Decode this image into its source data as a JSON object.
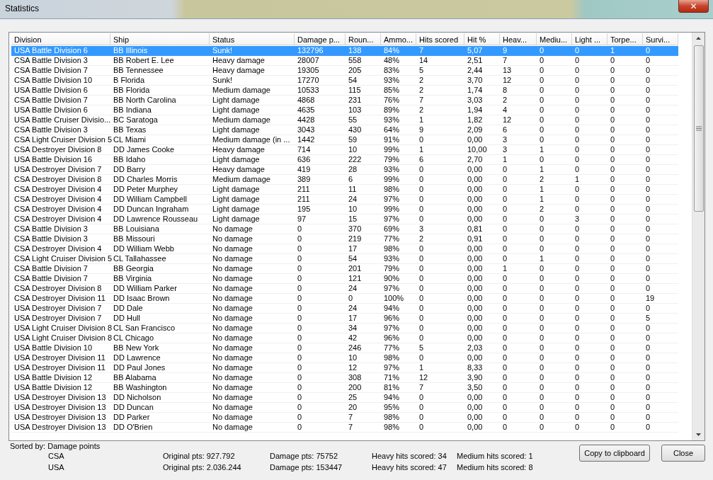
{
  "window": {
    "title": "Statistics",
    "close": "✕"
  },
  "table": {
    "columns": [
      "Division",
      "Ship",
      "Status",
      "Damage p...",
      "Roun...",
      "Ammo...",
      "Hits scored",
      "Hit %",
      "Heav...",
      "Mediu...",
      "Light ...",
      "Torpe...",
      "Survi..."
    ],
    "rows": [
      {
        "selected": true,
        "cells": [
          "USA Battle Division 6",
          "BB Illinois",
          "Sunk!",
          "132796",
          "138",
          "84%",
          "7",
          "5,07",
          "9",
          "0",
          "0",
          "1",
          "0"
        ]
      },
      {
        "selected": false,
        "cells": [
          "CSA Battle Division 3",
          "BB Robert E. Lee",
          "Heavy damage",
          "28007",
          "558",
          "48%",
          "14",
          "2,51",
          "7",
          "0",
          "0",
          "0",
          "0"
        ]
      },
      {
        "selected": false,
        "cells": [
          "CSA Battle Division 7",
          "BB Tennessee",
          "Heavy damage",
          "19305",
          "205",
          "83%",
          "5",
          "2,44",
          "13",
          "0",
          "0",
          "0",
          "0"
        ]
      },
      {
        "selected": false,
        "cells": [
          "CSA Battle Division 10",
          "B Florida",
          "Sunk!",
          "17270",
          "54",
          "93%",
          "2",
          "3,70",
          "12",
          "0",
          "0",
          "0",
          "0"
        ]
      },
      {
        "selected": false,
        "cells": [
          "USA Battle Division 6",
          "BB Florida",
          "Medium damage",
          "10533",
          "115",
          "85%",
          "2",
          "1,74",
          "8",
          "0",
          "0",
          "0",
          "0"
        ]
      },
      {
        "selected": false,
        "cells": [
          "CSA Battle Division 7",
          "BB North Carolina",
          "Light damage",
          "4868",
          "231",
          "76%",
          "7",
          "3,03",
          "2",
          "0",
          "0",
          "0",
          "0"
        ]
      },
      {
        "selected": false,
        "cells": [
          "USA Battle Division 6",
          "BB Indiana",
          "Light damage",
          "4635",
          "103",
          "89%",
          "2",
          "1,94",
          "4",
          "0",
          "0",
          "0",
          "0"
        ]
      },
      {
        "selected": false,
        "cells": [
          "USA Battle Cruiser Divisio...",
          "BC Saratoga",
          "Medium damage",
          "4428",
          "55",
          "93%",
          "1",
          "1,82",
          "12",
          "0",
          "0",
          "0",
          "0"
        ]
      },
      {
        "selected": false,
        "cells": [
          "CSA Battle Division 3",
          "BB Texas",
          "Light damage",
          "3043",
          "430",
          "64%",
          "9",
          "2,09",
          "6",
          "0",
          "0",
          "0",
          "0"
        ]
      },
      {
        "selected": false,
        "cells": [
          "CSA Light Cruiser Division 5",
          "CL Miami",
          "Medium damage (in ...",
          "1442",
          "59",
          "91%",
          "0",
          "0,00",
          "3",
          "0",
          "0",
          "0",
          "0"
        ]
      },
      {
        "selected": false,
        "cells": [
          "CSA Destroyer Division 8",
          "DD James Cooke",
          "Heavy damage",
          "714",
          "10",
          "99%",
          "1",
          "10,00",
          "3",
          "1",
          "0",
          "0",
          "0"
        ]
      },
      {
        "selected": false,
        "cells": [
          "USA Battle Division 16",
          "BB Idaho",
          "Light damage",
          "636",
          "222",
          "79%",
          "6",
          "2,70",
          "1",
          "0",
          "0",
          "0",
          "0"
        ]
      },
      {
        "selected": false,
        "cells": [
          "USA Destroyer Division 7",
          "DD Barry",
          "Heavy damage",
          "419",
          "28",
          "93%",
          "0",
          "0,00",
          "0",
          "1",
          "0",
          "0",
          "0"
        ]
      },
      {
        "selected": false,
        "cells": [
          "CSA Destroyer Division 8",
          "DD Charles Morris",
          "Medium damage",
          "389",
          "6",
          "99%",
          "0",
          "0,00",
          "0",
          "2",
          "1",
          "0",
          "0"
        ]
      },
      {
        "selected": false,
        "cells": [
          "CSA Destroyer Division 4",
          "DD Peter Murphey",
          "Light damage",
          "211",
          "11",
          "98%",
          "0",
          "0,00",
          "0",
          "1",
          "0",
          "0",
          "0"
        ]
      },
      {
        "selected": false,
        "cells": [
          "CSA Destroyer Division 4",
          "DD William Campbell",
          "Light damage",
          "211",
          "24",
          "97%",
          "0",
          "0,00",
          "0",
          "1",
          "0",
          "0",
          "0"
        ]
      },
      {
        "selected": false,
        "cells": [
          "CSA Destroyer Division 4",
          "DD Duncan Ingraham",
          "Light damage",
          "195",
          "10",
          "99%",
          "0",
          "0,00",
          "0",
          "2",
          "0",
          "0",
          "0"
        ]
      },
      {
        "selected": false,
        "cells": [
          "CSA Destroyer Division 4",
          "DD Lawrence Rousseau",
          "Light damage",
          "97",
          "15",
          "97%",
          "0",
          "0,00",
          "0",
          "0",
          "3",
          "0",
          "0"
        ]
      },
      {
        "selected": false,
        "cells": [
          "CSA Battle Division 3",
          "BB Louisiana",
          "No damage",
          "0",
          "370",
          "69%",
          "3",
          "0,81",
          "0",
          "0",
          "0",
          "0",
          "0"
        ]
      },
      {
        "selected": false,
        "cells": [
          "CSA Battle Division 3",
          "BB Missouri",
          "No damage",
          "0",
          "219",
          "77%",
          "2",
          "0,91",
          "0",
          "0",
          "0",
          "0",
          "0"
        ]
      },
      {
        "selected": false,
        "cells": [
          "CSA Destroyer Division 4",
          "DD William Webb",
          "No damage",
          "0",
          "17",
          "98%",
          "0",
          "0,00",
          "0",
          "0",
          "0",
          "0",
          "0"
        ]
      },
      {
        "selected": false,
        "cells": [
          "CSA Light Cruiser Division 5",
          "CL Tallahassee",
          "No damage",
          "0",
          "54",
          "93%",
          "0",
          "0,00",
          "0",
          "1",
          "0",
          "0",
          "0"
        ]
      },
      {
        "selected": false,
        "cells": [
          "CSA Battle Division 7",
          "BB Georgia",
          "No damage",
          "0",
          "201",
          "79%",
          "0",
          "0,00",
          "1",
          "0",
          "0",
          "0",
          "0"
        ]
      },
      {
        "selected": false,
        "cells": [
          "CSA Battle Division 7",
          "BB Virginia",
          "No damage",
          "0",
          "121",
          "90%",
          "0",
          "0,00",
          "0",
          "0",
          "0",
          "0",
          "0"
        ]
      },
      {
        "selected": false,
        "cells": [
          "CSA Destroyer Division 8",
          "DD William Parker",
          "No damage",
          "0",
          "24",
          "97%",
          "0",
          "0,00",
          "0",
          "0",
          "0",
          "0",
          "0"
        ]
      },
      {
        "selected": false,
        "cells": [
          "CSA Destroyer Division 11",
          "DD Isaac Brown",
          "No damage",
          "0",
          "0",
          "100%",
          "0",
          "0,00",
          "0",
          "0",
          "0",
          "0",
          "19"
        ]
      },
      {
        "selected": false,
        "cells": [
          "USA Destroyer Division 7",
          "DD Dale",
          "No damage",
          "0",
          "24",
          "94%",
          "0",
          "0,00",
          "0",
          "0",
          "0",
          "0",
          "0"
        ]
      },
      {
        "selected": false,
        "cells": [
          "USA Destroyer Division 7",
          "DD Hull",
          "No damage",
          "0",
          "17",
          "96%",
          "0",
          "0,00",
          "0",
          "0",
          "0",
          "0",
          "5"
        ]
      },
      {
        "selected": false,
        "cells": [
          "USA Light Cruiser Division 8",
          "CL San Francisco",
          "No damage",
          "0",
          "34",
          "97%",
          "0",
          "0,00",
          "0",
          "0",
          "0",
          "0",
          "0"
        ]
      },
      {
        "selected": false,
        "cells": [
          "USA Light Cruiser Division 8",
          "CL Chicago",
          "No damage",
          "0",
          "42",
          "96%",
          "0",
          "0,00",
          "0",
          "0",
          "0",
          "0",
          "0"
        ]
      },
      {
        "selected": false,
        "cells": [
          "USA Battle Division 10",
          "BB New York",
          "No damage",
          "0",
          "246",
          "77%",
          "5",
          "2,03",
          "0",
          "0",
          "0",
          "0",
          "0"
        ]
      },
      {
        "selected": false,
        "cells": [
          "USA Destroyer Division 11",
          "DD Lawrence",
          "No damage",
          "0",
          "10",
          "98%",
          "0",
          "0,00",
          "0",
          "0",
          "0",
          "0",
          "0"
        ]
      },
      {
        "selected": false,
        "cells": [
          "USA Destroyer Division 11",
          "DD Paul Jones",
          "No damage",
          "0",
          "12",
          "97%",
          "1",
          "8,33",
          "0",
          "0",
          "0",
          "0",
          "0"
        ]
      },
      {
        "selected": false,
        "cells": [
          "USA Battle Division 12",
          "BB Alabama",
          "No damage",
          "0",
          "308",
          "71%",
          "12",
          "3,90",
          "0",
          "0",
          "0",
          "0",
          "0"
        ]
      },
      {
        "selected": false,
        "cells": [
          "USA Battle Division 12",
          "BB Washington",
          "No damage",
          "0",
          "200",
          "81%",
          "7",
          "3,50",
          "0",
          "0",
          "0",
          "0",
          "0"
        ]
      },
      {
        "selected": false,
        "cells": [
          "USA Destroyer Division 13",
          "DD Nicholson",
          "No damage",
          "0",
          "25",
          "94%",
          "0",
          "0,00",
          "0",
          "0",
          "0",
          "0",
          "0"
        ]
      },
      {
        "selected": false,
        "cells": [
          "USA Destroyer Division 13",
          "DD Duncan",
          "No damage",
          "0",
          "20",
          "95%",
          "0",
          "0,00",
          "0",
          "0",
          "0",
          "0",
          "0"
        ]
      },
      {
        "selected": false,
        "cells": [
          "USA Destroyer Division 13",
          "DD Parker",
          "No damage",
          "0",
          "7",
          "98%",
          "0",
          "0,00",
          "0",
          "0",
          "0",
          "0",
          "0"
        ]
      },
      {
        "selected": false,
        "cells": [
          "USA Destroyer Division 13",
          "DD O'Brien",
          "No damage",
          "0",
          "7",
          "98%",
          "0",
          "0,00",
          "0",
          "0",
          "0",
          "0",
          "0"
        ]
      }
    ]
  },
  "sorted_by": "Sorted by: Damage points",
  "summary": [
    {
      "side": "CSA",
      "original": "Original pts: 927.792",
      "damage": "Damage pts: 75752",
      "heavy": "Heavy hits scored: 34",
      "medium": "Medium hits scored: 1"
    },
    {
      "side": "USA",
      "original": "Original pts: 2.036.244",
      "damage": "Damage pts: 153447",
      "heavy": "Heavy hits scored: 47",
      "medium": "Medium hits scored: 8"
    }
  ],
  "buttons": [
    "Copy to clipboard",
    "Close"
  ]
}
